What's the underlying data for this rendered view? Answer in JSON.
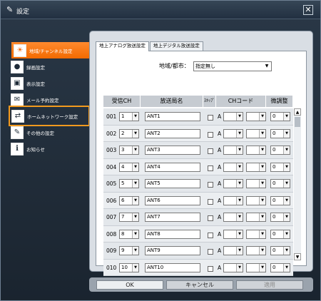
{
  "window": {
    "title": "設定",
    "close_label": "✕"
  },
  "sidebar": {
    "items": [
      {
        "label": "地域/チャンネル設定",
        "icon": "antenna-icon",
        "glyph": "☀",
        "active": true
      },
      {
        "label": "録画設定",
        "icon": "record-icon",
        "glyph": "●"
      },
      {
        "label": "表示設定",
        "icon": "display-icon",
        "glyph": "▣"
      },
      {
        "label": "メール予約設定",
        "icon": "mail-icon",
        "glyph": "✉"
      },
      {
        "label": "ホームネットワーク設定",
        "icon": "home-network-icon",
        "glyph": "⇄",
        "highlight": true
      },
      {
        "label": "その他の設定",
        "icon": "wrench-icon",
        "glyph": "✎"
      },
      {
        "label": "お知らせ",
        "icon": "info-icon",
        "glyph": "i"
      }
    ]
  },
  "tabs": [
    {
      "label": "地上アナログ放送設定",
      "active": true
    },
    {
      "label": "地上デジタル放送設定",
      "active": false
    }
  ],
  "region": {
    "label": "地域/都市：",
    "value": "指定無し"
  },
  "columns": [
    "受信CH",
    "放送局名",
    "ｽｷｯﾌﾟ",
    "CHコード",
    "微調整"
  ],
  "rows": [
    {
      "no": "001",
      "ch": "1",
      "name": "ANT1",
      "code_prefix": "A",
      "fine": "0"
    },
    {
      "no": "002",
      "ch": "2",
      "name": "ANT2",
      "code_prefix": "A",
      "fine": "0"
    },
    {
      "no": "003",
      "ch": "3",
      "name": "ANT3",
      "code_prefix": "A",
      "fine": "0"
    },
    {
      "no": "004",
      "ch": "4",
      "name": "ANT4",
      "code_prefix": "A",
      "fine": "0"
    },
    {
      "no": "005",
      "ch": "5",
      "name": "ANT5",
      "code_prefix": "A",
      "fine": "0"
    },
    {
      "no": "006",
      "ch": "6",
      "name": "ANT6",
      "code_prefix": "A",
      "fine": "0"
    },
    {
      "no": "007",
      "ch": "7",
      "name": "ANT7",
      "code_prefix": "A",
      "fine": "0"
    },
    {
      "no": "008",
      "ch": "8",
      "name": "ANT8",
      "code_prefix": "A",
      "fine": "0"
    },
    {
      "no": "009",
      "ch": "9",
      "name": "ANT9",
      "code_prefix": "A",
      "fine": "0"
    },
    {
      "no": "010",
      "ch": "10",
      "name": "ANT10",
      "code_prefix": "A",
      "fine": "0"
    }
  ],
  "buttons": {
    "ok": "OK",
    "cancel": "キャンセル",
    "apply": "適用"
  },
  "colors": {
    "active_item": "#f26a00",
    "highlight_outline": "#f39a1e",
    "window_bg": "#1c2733"
  }
}
